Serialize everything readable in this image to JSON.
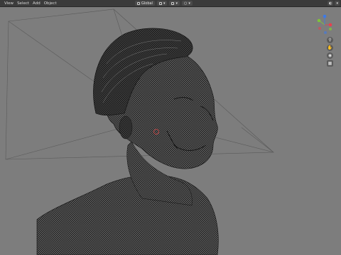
{
  "menu": {
    "items": [
      "View",
      "Select",
      "Add",
      "Object"
    ]
  },
  "header": {
    "transform_orientation": "Global",
    "pivot_icon": "pivot-icon",
    "snap_icon": "snap-icon",
    "proportional_icon": "proportional-edit-icon"
  },
  "gizmo": {
    "axis_x_color": "#e8404f",
    "axis_y_color": "#80c23b",
    "axis_z_color": "#3c7ae8",
    "icons": [
      "zoom-icon",
      "hand-pan-icon",
      "camera-icon",
      "grid-icon"
    ]
  },
  "viewport": {
    "background": "#7d7d7d",
    "mesh_color": "#2c2c2c",
    "object": "sculpted bust"
  }
}
